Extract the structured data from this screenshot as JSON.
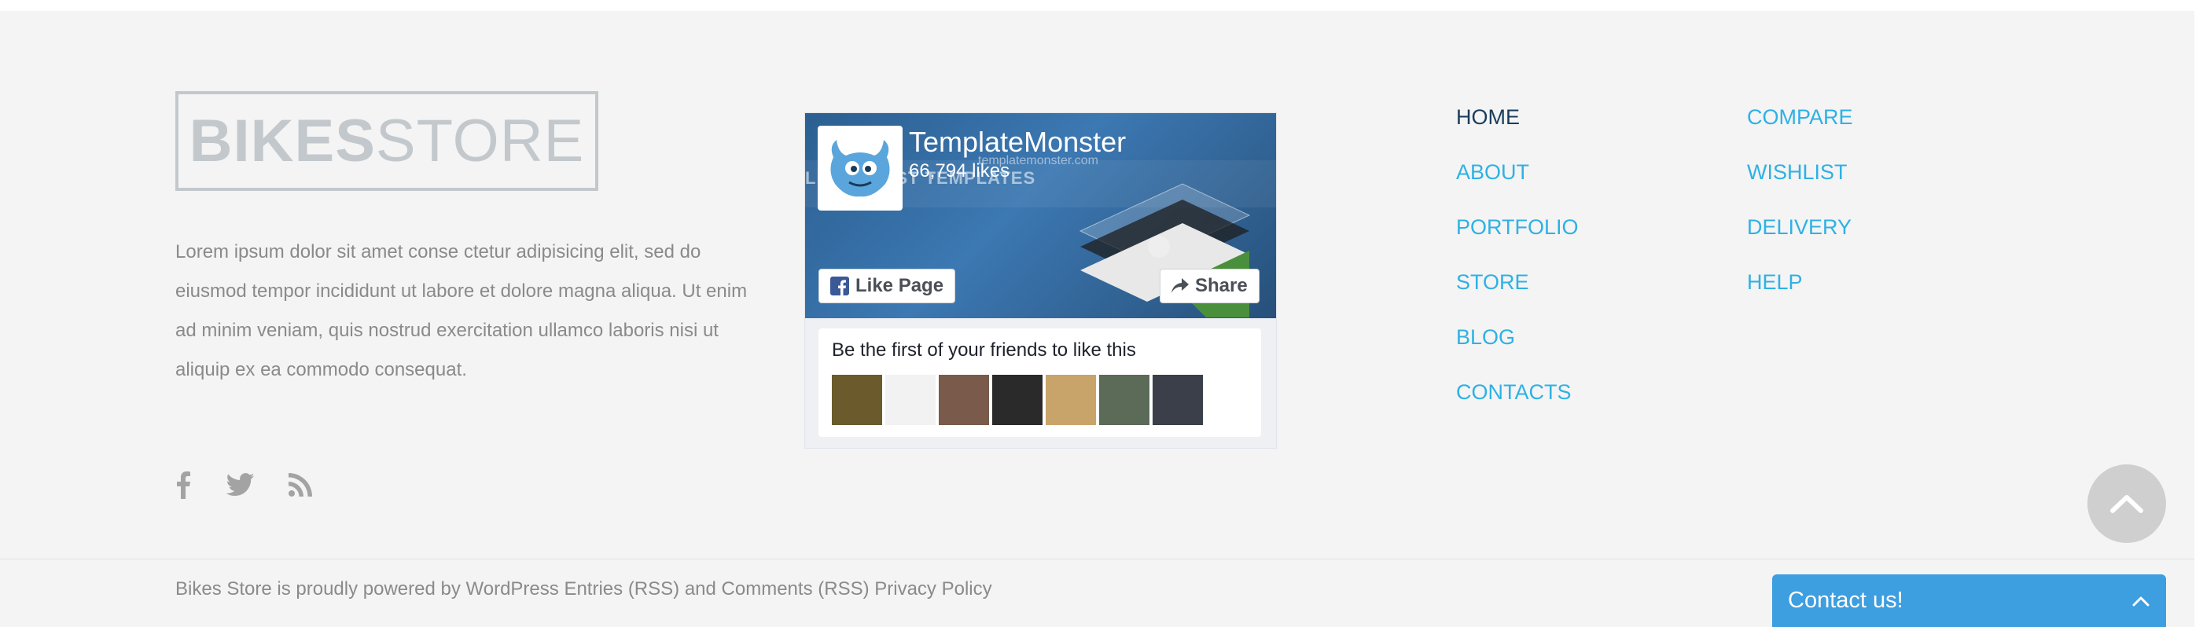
{
  "logo": {
    "bold": "BIKES",
    "light": "STORE"
  },
  "description": "Lorem ipsum dolor sit amet conse ctetur adipisicing elit, sed do eiusmod tempor incididunt ut labore et dolore magna aliqua. Ut enim ad minim veniam, quis nostrud exercitation ullamco laboris nisi ut aliquip ex ea commodo consequat.",
  "social": [
    {
      "icon": "facebook-icon"
    },
    {
      "icon": "twitter-icon"
    },
    {
      "icon": "rss-icon"
    }
  ],
  "facebook": {
    "page_name": "TemplateMonster",
    "likes": "66,794 likes",
    "cover_url": "templatemonster.com",
    "cover_banner": "LI    THE BEST TEMPLATES",
    "like_button": "Like Page",
    "share_button": "Share",
    "friends_text": "Be the first of your friends to like this",
    "friend_count": 7
  },
  "nav": {
    "col1": [
      {
        "label": "HOME",
        "active": true
      },
      {
        "label": "ABOUT"
      },
      {
        "label": "PORTFOLIO"
      },
      {
        "label": "STORE"
      },
      {
        "label": "BLOG"
      },
      {
        "label": "CONTACTS"
      }
    ],
    "col2": [
      {
        "label": "COMPARE"
      },
      {
        "label": "WISHLIST"
      },
      {
        "label": "DELIVERY"
      },
      {
        "label": "HELP"
      }
    ]
  },
  "footer": {
    "prefix": "Bikes Store is proudly powered by ",
    "wordpress": "WordPress",
    "entries": "Entries (RSS)",
    "and": " and ",
    "comments": "Comments (RSS)",
    "privacy": "Privacy Policy"
  },
  "contact": {
    "label": "Contact us!"
  },
  "colors": {
    "accent": "#2eb1e5",
    "nav_active": "#1a3d5c",
    "contact_bg": "#3d9ee0",
    "background": "#f4f4f4"
  }
}
